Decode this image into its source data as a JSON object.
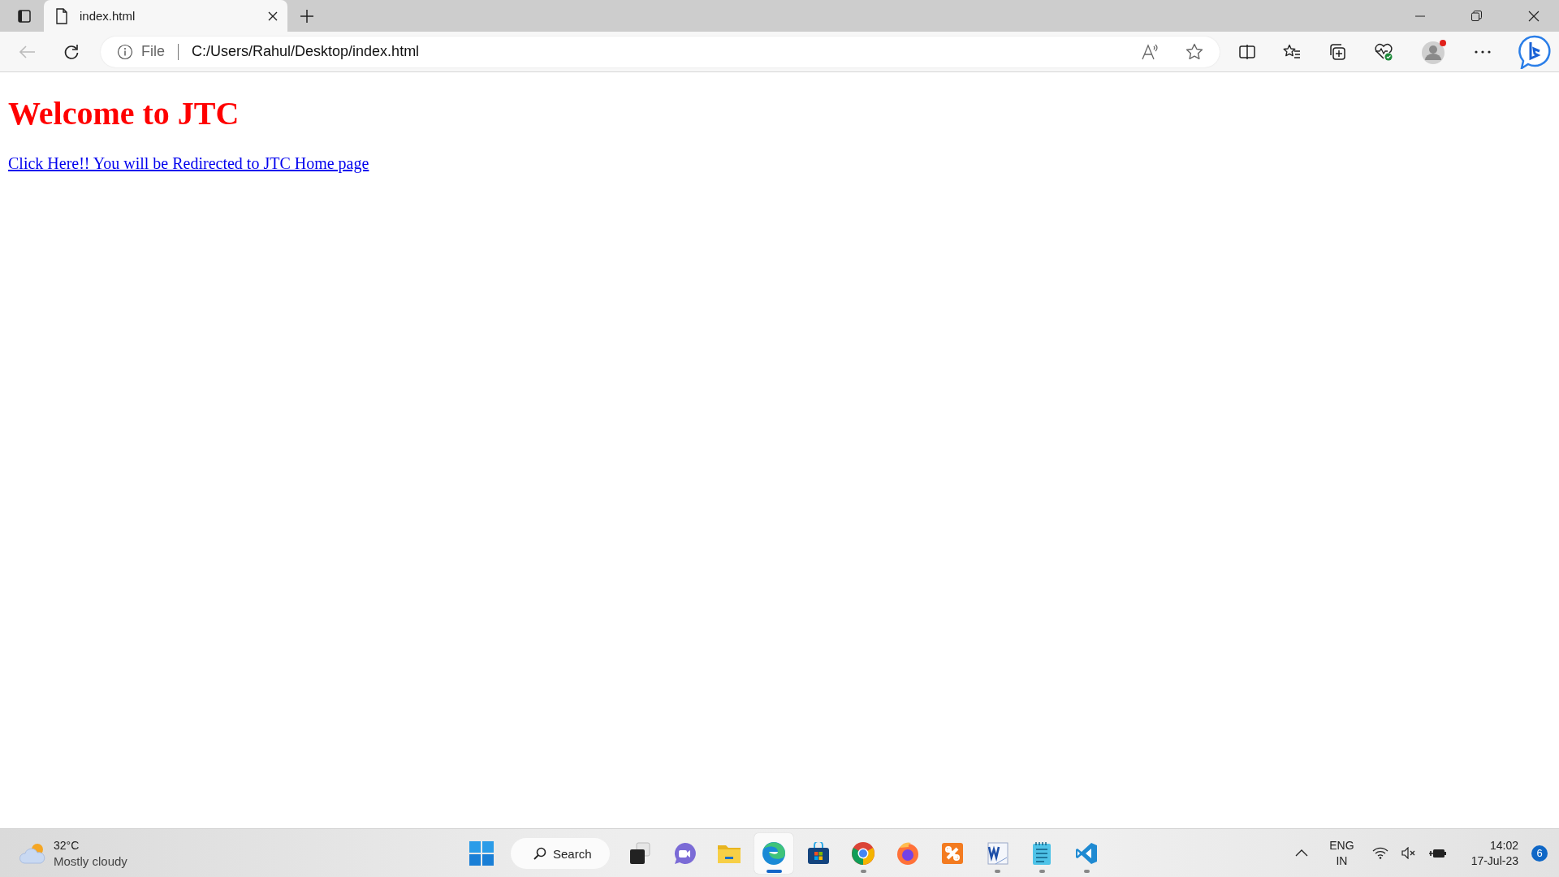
{
  "tab": {
    "title": "index.html",
    "selected": true
  },
  "address_bar": {
    "scheme": "File",
    "url": "C:/Users/Rahul/Desktop/index.html"
  },
  "page": {
    "heading": "Welcome to JTC",
    "link": "Click Here!! You will be Redirected to JTC Home page"
  },
  "taskbar": {
    "weather": {
      "temperature": "32°C",
      "condition": "Mostly cloudy"
    },
    "search": {
      "placeholder": "Search"
    },
    "apps": [
      {
        "kind": "taskview",
        "running": false,
        "selected": false
      },
      {
        "kind": "chat",
        "running": false,
        "selected": false
      },
      {
        "kind": "files",
        "running": false,
        "selected": false
      },
      {
        "kind": "edge",
        "running": true,
        "selected": true
      },
      {
        "kind": "store",
        "running": false,
        "selected": false
      },
      {
        "kind": "chrome",
        "running": true,
        "selected": false
      },
      {
        "kind": "firefox",
        "running": false,
        "selected": false
      },
      {
        "kind": "xampp",
        "running": false,
        "selected": false
      },
      {
        "kind": "word",
        "running": true,
        "selected": false
      },
      {
        "kind": "notepad",
        "running": true,
        "selected": false
      },
      {
        "kind": "vscode",
        "running": true,
        "selected": false
      }
    ],
    "language": {
      "line_1": "ENG",
      "line_2": "IN"
    },
    "clock": {
      "time": "14:02",
      "date": "17-Jul-23"
    },
    "notification_count": "6"
  }
}
